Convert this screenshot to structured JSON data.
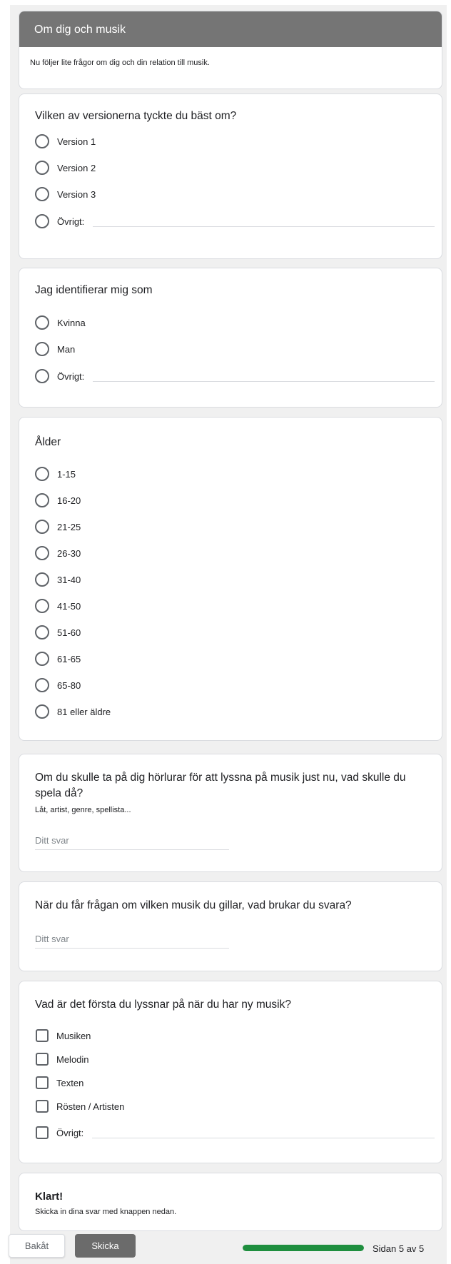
{
  "section": {
    "title": "Om dig och musik",
    "description": "Nu följer lite frågor om dig och din relation till musik."
  },
  "q_version": {
    "title": "Vilken av versionerna tyckte du bäst om?",
    "options": [
      "Version 1",
      "Version 2",
      "Version 3"
    ],
    "other_label": "Övrigt:"
  },
  "q_identity": {
    "title": "Jag identifierar mig som",
    "options": [
      "Kvinna",
      "Man"
    ],
    "other_label": "Övrigt:"
  },
  "q_age": {
    "title": "Ålder",
    "options": [
      "1-15",
      "16-20",
      "21-25",
      "26-30",
      "31-40",
      "41-50",
      "51-60",
      "61-65",
      "65-80",
      "81 eller äldre"
    ]
  },
  "q_headphones": {
    "title": "Om du skulle ta på dig hörlurar för att lyssna på musik just nu, vad skulle du spela då?",
    "helper": "Låt, artist, genre, spellista...",
    "placeholder": "Ditt svar"
  },
  "q_answer": {
    "title": "När du får frågan om vilken musik du gillar, vad brukar du svara?",
    "placeholder": "Ditt svar"
  },
  "q_first": {
    "title": "Vad är det första du lyssnar på när du har ny musik?",
    "options": [
      "Musiken",
      "Melodin",
      "Texten",
      "Rösten / Artisten"
    ],
    "other_label": "Övrigt:"
  },
  "done": {
    "title": "Klart!",
    "description": "Skicka in dina svar med knappen nedan."
  },
  "nav": {
    "back_label": "Bakåt",
    "submit_label": "Skicka"
  },
  "progress": {
    "fraction": 1.0,
    "label": "Sidan 5 av 5",
    "color": "#1e8e3e"
  },
  "colors": {
    "header_bg": "#757575",
    "submit_bg": "#6b6b6b",
    "page_bg": "#f0f0f0"
  }
}
